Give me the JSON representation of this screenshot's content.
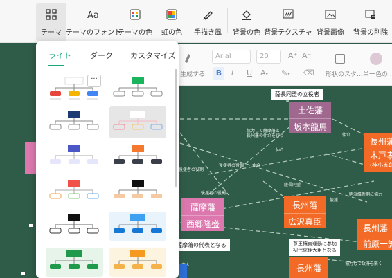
{
  "toolbar": {
    "items": [
      {
        "label": "テーマ",
        "icon": "grid-icon"
      },
      {
        "label": "テーマのフォント",
        "icon": "font-icon"
      },
      {
        "label": "テーマの色",
        "icon": "palette-icon"
      },
      {
        "label": "虹の色",
        "icon": "rainbow-icon"
      },
      {
        "label": "手描き風",
        "icon": "pen-icon"
      },
      {
        "label": "背景の色",
        "icon": "paint-bucket-icon"
      },
      {
        "label": "背景テクスチャ",
        "icon": "texture-icon"
      },
      {
        "label": "背景画像",
        "icon": "image-icon"
      },
      {
        "label": "背景の削除",
        "icon": "delete-background-icon"
      }
    ]
  },
  "theme_panel": {
    "tabs": [
      "ライト",
      "ダーク",
      "カスタマイズ"
    ],
    "more_label": "···"
  },
  "format_bar": {
    "generate_label": "生成する",
    "font_value": "Arial",
    "font_size_value": "20",
    "shape_style_label": "形状のスタ...",
    "single_color_label": "単一色の..."
  },
  "canvas": {
    "nodes": [
      {
        "id": "tosa",
        "top": "土佐藩",
        "bottom": "坂本龍馬"
      },
      {
        "id": "satsuma",
        "top": "薩摩藩",
        "bottom": "西郷隆盛"
      },
      {
        "id": "choshu-hirosawa",
        "top": "長州藩",
        "bottom": "広沢真臣"
      },
      {
        "id": "choshu-kido",
        "top": "長州藩",
        "bottom": "木戸孝",
        "extra": "(桂小五郎)"
      },
      {
        "id": "choshu-maebara",
        "top": "長州藩",
        "bottom": "前原一誠"
      },
      {
        "id": "choshu-bottom",
        "top": "長州藩"
      }
    ],
    "labels": [
      "薩長同盟の立役者",
      "薩摩藩の代表となる",
      "尊王攘夷運動に参加\n初代総理大臣となる"
    ],
    "small_texts": [
      "協力して薩摩藩と\n長州藩の仲介を行う",
      "仲介",
      "仲介",
      "仲介",
      "後",
      "後援者の役割",
      "後援者の役割",
      "後援者の役割",
      "後援",
      "薩長同盟",
      "明治維新期に協力",
      "協力して政府を築く",
      "主人"
    ]
  }
}
